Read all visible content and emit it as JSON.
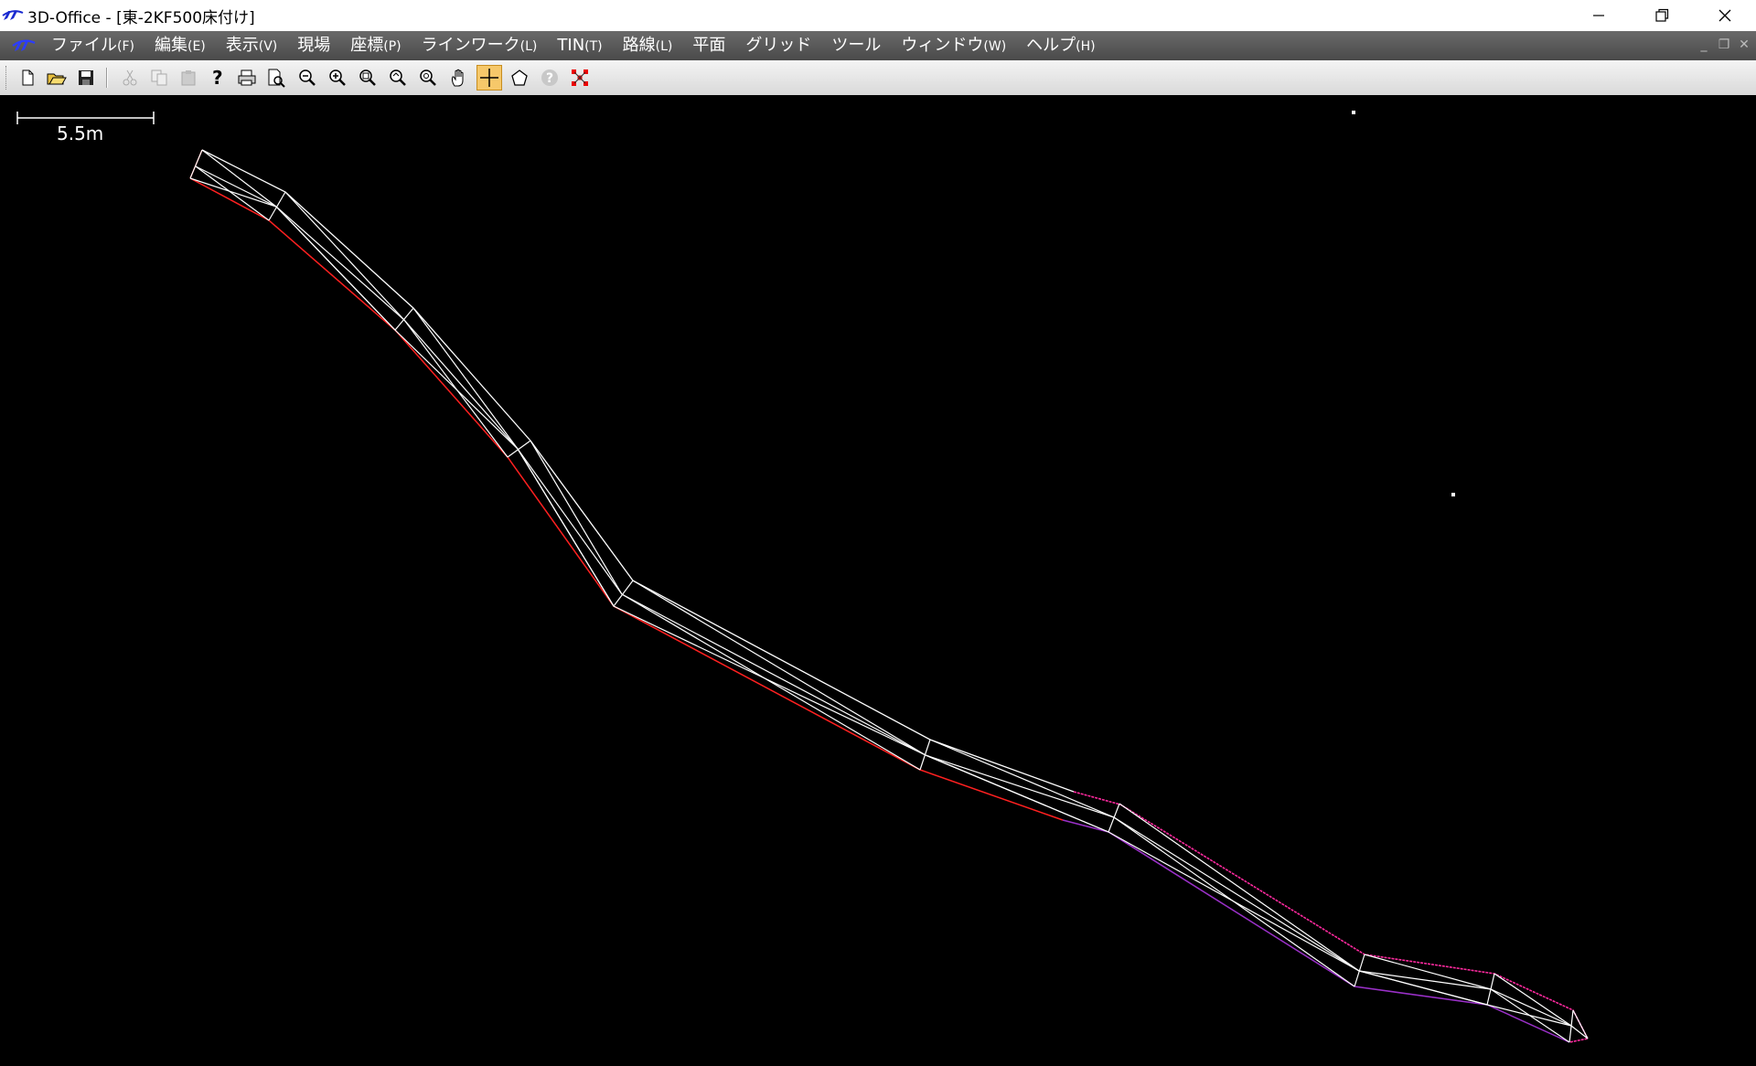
{
  "window": {
    "title": "3D-Office - [東-2KF500床付け]",
    "controls": [
      "minimize-icon",
      "restore-icon",
      "close-icon"
    ]
  },
  "menubar": {
    "items": [
      {
        "label": "ファイル",
        "accel": "(F)"
      },
      {
        "label": "編集",
        "accel": "(E)"
      },
      {
        "label": "表示",
        "accel": "(V)"
      },
      {
        "label": "現場",
        "accel": ""
      },
      {
        "label": "座標",
        "accel": "(P)"
      },
      {
        "label": "ラインワーク",
        "accel": "(L)"
      },
      {
        "label": "TIN",
        "accel": "(T)"
      },
      {
        "label": "路線",
        "accel": "(L)"
      },
      {
        "label": "平面",
        "accel": ""
      },
      {
        "label": "グリッド",
        "accel": ""
      },
      {
        "label": "ツール",
        "accel": ""
      },
      {
        "label": "ウィンドウ",
        "accel": "(W)"
      },
      {
        "label": "ヘルプ",
        "accel": "(H)"
      }
    ],
    "mdi_controls": [
      "_",
      "❐",
      "✕"
    ]
  },
  "toolbar": {
    "buttons": [
      {
        "icon": "new-file-icon",
        "enabled": true
      },
      {
        "icon": "open-folder-icon",
        "enabled": true
      },
      {
        "icon": "save-icon",
        "enabled": true
      },
      {
        "icon": "cut-icon",
        "enabled": false
      },
      {
        "icon": "copy-icon",
        "enabled": false
      },
      {
        "icon": "paste-icon",
        "enabled": false
      },
      {
        "icon": "help-pointer-icon",
        "enabled": true
      },
      {
        "icon": "print-icon",
        "enabled": true
      },
      {
        "icon": "print-preview-icon",
        "enabled": true
      },
      {
        "icon": "zoom-out-icon",
        "enabled": true
      },
      {
        "icon": "zoom-in-icon",
        "enabled": true
      },
      {
        "icon": "zoom-window-icon",
        "enabled": true
      },
      {
        "icon": "zoom-previous-icon",
        "enabled": true
      },
      {
        "icon": "zoom-all-icon",
        "enabled": true
      },
      {
        "icon": "pan-hand-icon",
        "enabled": true
      },
      {
        "icon": "crosshair-icon",
        "enabled": true,
        "active": true
      },
      {
        "icon": "polygon-icon",
        "enabled": true
      },
      {
        "icon": "help-icon",
        "enabled": false
      },
      {
        "icon": "points-icon",
        "enabled": true
      }
    ]
  },
  "canvas": {
    "scale_bar_label": "5.5m",
    "colors": {
      "background": "#000000",
      "mesh_line": "#ffffff",
      "edge_red": "#ff2020",
      "edge_magenta": "#ff2aa0",
      "edge_purple": "#9a30c8"
    }
  }
}
